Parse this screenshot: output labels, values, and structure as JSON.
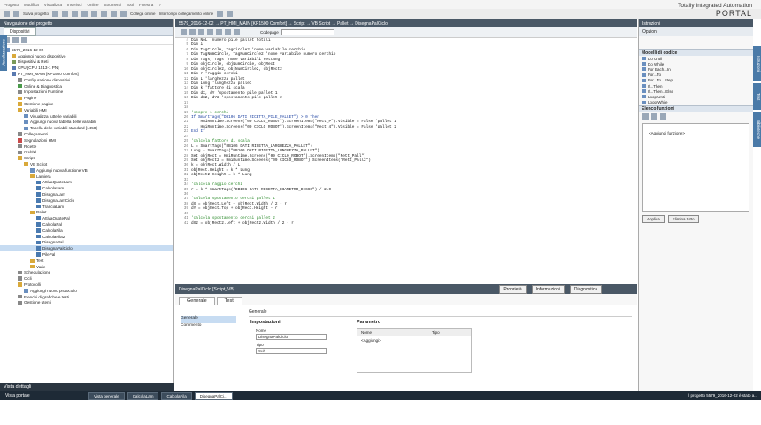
{
  "menu": [
    "Progetto",
    "Modifica",
    "Visualizza",
    "Inserisci",
    "Online",
    "Strumenti",
    "Tool",
    "Finestra",
    "?"
  ],
  "toolbar": {
    "save": "Salva progetto",
    "connect": "Collega online",
    "disconnect": "Interrompi collegamento online"
  },
  "brand": {
    "line1": "Totally Integrated Automation",
    "line2": "PORTAL"
  },
  "nav": {
    "title": "Navigazione del progetto",
    "tab": "Dispositivi",
    "vtab": "Visualizzazione",
    "items": [
      {
        "label": "5579_2016-12-02",
        "indent": 0,
        "icon": "#6a8fbf"
      },
      {
        "label": "Aggiungi nuovo dispositivo",
        "indent": 1,
        "icon": "#d9a93a"
      },
      {
        "label": "Dispositivi & Reti",
        "indent": 1,
        "icon": "#7a9a5a"
      },
      {
        "label": "CPU [CPU 1513-1 PN]",
        "indent": 1,
        "icon": "#5a7ab0"
      },
      {
        "label": "PT_HMI_MAIN [KP1500 Comfort]",
        "indent": 1,
        "icon": "#5a7ab0"
      },
      {
        "label": "Configurazione dispositivi",
        "indent": 2,
        "icon": "#888"
      },
      {
        "label": "Online & Diagnostica",
        "indent": 2,
        "icon": "#4a9a4a"
      },
      {
        "label": "Impostazioni Runtime",
        "indent": 2,
        "icon": "#888"
      },
      {
        "label": "Pagine",
        "indent": 2,
        "icon": "#d9a93a"
      },
      {
        "label": "Gestione pagine",
        "indent": 2,
        "icon": "#d9a93a"
      },
      {
        "label": "Variabili HMI",
        "indent": 2,
        "icon": "#d9a93a"
      },
      {
        "label": "Visualizza tutte le variabili",
        "indent": 3,
        "icon": "#6a8fbf"
      },
      {
        "label": "Aggiungi nuova tabella delle variabili",
        "indent": 3,
        "icon": "#6a8fbf"
      },
      {
        "label": "Tabella delle variabili standard [1458]",
        "indent": 3,
        "icon": "#6a8fbf"
      },
      {
        "label": "Collegamenti",
        "indent": 2,
        "icon": "#888"
      },
      {
        "label": "Segnalazioni HMI",
        "indent": 2,
        "icon": "#c94a4a"
      },
      {
        "label": "Ricette",
        "indent": 2,
        "icon": "#888"
      },
      {
        "label": "Archivi",
        "indent": 2,
        "icon": "#888"
      },
      {
        "label": "Script",
        "indent": 2,
        "icon": "#d9a93a"
      },
      {
        "label": "VB Script",
        "indent": 3,
        "icon": "#d9a93a"
      },
      {
        "label": "Aggiungi nuova funzione VB",
        "indent": 4,
        "icon": "#6a8fbf"
      },
      {
        "label": "Lamiera",
        "indent": 4,
        "icon": "#d9a93a"
      },
      {
        "label": "AttivaQuoteLam",
        "indent": 5,
        "icon": "#4a7ab0"
      },
      {
        "label": "CalcolaLam",
        "indent": 5,
        "icon": "#4a7ab0"
      },
      {
        "label": "DisegnaLam",
        "indent": 5,
        "icon": "#4a7ab0"
      },
      {
        "label": "DisegnaLamCiclo",
        "indent": 5,
        "icon": "#4a7ab0"
      },
      {
        "label": "TranciaLam",
        "indent": 5,
        "icon": "#4a7ab0"
      },
      {
        "label": "Pallet",
        "indent": 4,
        "icon": "#d9a93a"
      },
      {
        "label": "AttivaQuotePal",
        "indent": 5,
        "icon": "#4a7ab0"
      },
      {
        "label": "CalcolaPal",
        "indent": 5,
        "icon": "#4a7ab0"
      },
      {
        "label": "CalcolaFila",
        "indent": 5,
        "icon": "#4a7ab0"
      },
      {
        "label": "CalcolaFila2",
        "indent": 5,
        "icon": "#4a7ab0"
      },
      {
        "label": "DisegnaPal",
        "indent": 5,
        "icon": "#4a7ab0"
      },
      {
        "label": "DisegnaPalCiclo",
        "indent": 5,
        "icon": "#4a7ab0",
        "selected": true
      },
      {
        "label": "PilePal",
        "indent": 5,
        "icon": "#4a7ab0"
      },
      {
        "label": "Test",
        "indent": 4,
        "icon": "#d9a93a"
      },
      {
        "label": "Varie",
        "indent": 4,
        "icon": "#d9a93a"
      },
      {
        "label": "Schedulazione",
        "indent": 2,
        "icon": "#888"
      },
      {
        "label": "Cicli",
        "indent": 2,
        "icon": "#888"
      },
      {
        "label": "Protocolli",
        "indent": 2,
        "icon": "#d9a93a"
      },
      {
        "label": "Aggiungi nuovo protocollo",
        "indent": 3,
        "icon": "#6a8fbf"
      },
      {
        "label": "Elenchi di grafiche e testi",
        "indent": 2,
        "icon": "#888"
      },
      {
        "label": "Gestione utenti",
        "indent": 2,
        "icon": "#888"
      }
    ],
    "details": "Vista dettagli"
  },
  "editor": {
    "title": "5579_2016-12-02 → PT_HMI_MAIN [KP1500 Comfort] → Script → VB Script → Pallet → DisegnaPalCiclo",
    "codepage_label": "Codepage",
    "lines": [
      {
        "n": "4",
        "t": "Dim NoL 'numero pile pallet totali",
        "k": ""
      },
      {
        "n": "5",
        "t": "Dim i",
        "k": ""
      },
      {
        "n": "6",
        "t": "Dim TagCircle, TagCircle2 'nome variabile cerchio",
        "k": ""
      },
      {
        "n": "7",
        "t": "Dim TagNumCircle, TagNumCircle2 'nome variabile numero cerchio",
        "k": ""
      },
      {
        "n": "8",
        "t": "Dim Tags, Tags 'nome variabili rettang",
        "k": ""
      },
      {
        "n": "9",
        "t": "Dim objCircle, objNumCircle, objRect",
        "k": ""
      },
      {
        "n": "10",
        "t": "Dim objCircle2, objNumCircle2, objRect2",
        "k": ""
      },
      {
        "n": "11",
        "t": "Dim r 'raggio cerchi",
        "k": ""
      },
      {
        "n": "12",
        "t": "Dim L 'larghezza pallet",
        "k": ""
      },
      {
        "n": "13",
        "t": "Dim Lung 'lunghezza pallet",
        "k": ""
      },
      {
        "n": "14",
        "t": "Dim k 'fattore di scala",
        "k": ""
      },
      {
        "n": "15",
        "t": "Dim dX, dY 'spostamento pile pallet 1",
        "k": ""
      },
      {
        "n": "16",
        "t": "Dim dX2, dY2 'spostamento pile pallet 2",
        "k": ""
      },
      {
        "n": "17",
        "t": "",
        "k": ""
      },
      {
        "n": "18",
        "t": "",
        "k": ""
      },
      {
        "n": "19",
        "t": "'scopre i cerchi",
        "k": "cm"
      },
      {
        "n": "20",
        "t": "If SmartTags(\"DB106 DATI RICETTA_PILE_PALLET\") > 0 Then",
        "k": "kw"
      },
      {
        "n": "21",
        "t": "    HmiRuntime.Screens(\"09 CICLO_ROBOT\").ScreenItems(\"Rect_P\").Visible = False 'pallet 1",
        "k": ""
      },
      {
        "n": "22",
        "t": "    HmiRuntime.Screens(\"09 CICLO_ROBOT\").ScreenItems(\"Rect_4\").Visible = False 'pallet 2",
        "k": ""
      },
      {
        "n": "23",
        "t": "End If",
        "k": "kw"
      },
      {
        "n": "24",
        "t": "",
        "k": ""
      },
      {
        "n": "25",
        "t": "'calcola fattore di scala",
        "k": "cm"
      },
      {
        "n": "26",
        "t": "L = SmartTags(\"DB106 DATI RICETTA_LARGHEZZA_PALLET\")",
        "k": ""
      },
      {
        "n": "27",
        "t": "Lung = SmartTags(\"DB106 DATI RICETTA_LUNGHEZZA_PALLET\")",
        "k": ""
      },
      {
        "n": "28",
        "t": "Set objRect = HmiRuntime.Screens(\"09 CICLO_ROBOT\").ScreenItems(\"Rett_Pall\")",
        "k": ""
      },
      {
        "n": "29",
        "t": "Set objRect2 = HmiRuntime.Screens(\"09 CICLO_ROBOT\").ScreenItems(\"Rett_Pall2\")",
        "k": ""
      },
      {
        "n": "30",
        "t": "k = objRect.Width / L",
        "k": ""
      },
      {
        "n": "31",
        "t": "objRect.Height = k * Lung",
        "k": ""
      },
      {
        "n": "32",
        "t": "objRect2.Height = k * Lung",
        "k": ""
      },
      {
        "n": "33",
        "t": "",
        "k": ""
      },
      {
        "n": "34",
        "t": "'calcola raggio cerchi",
        "k": "cm"
      },
      {
        "n": "35",
        "t": "r = k * SmartTags(\"DB106 DATI RICETTA_DIAMETRO_DISCO\") / 2.0",
        "k": ""
      },
      {
        "n": "36",
        "t": "",
        "k": ""
      },
      {
        "n": "37",
        "t": "'calcola spostamento cerchi pallet 1",
        "k": "cm"
      },
      {
        "n": "38",
        "t": "dX = objRect.Left + objRect.Width / 2 - r",
        "k": ""
      },
      {
        "n": "39",
        "t": "dY = objRect.Top + objRect.Height - r",
        "k": ""
      },
      {
        "n": "40",
        "t": "",
        "k": ""
      },
      {
        "n": "41",
        "t": "'calcola spostamento cerchi pallet 2",
        "k": "cm"
      },
      {
        "n": "42",
        "t": "dX2 = objRect2.Left + objRect2.Width / 2 - r",
        "k": ""
      }
    ]
  },
  "props": {
    "title": "DisegnaPalCiclo [Script_VB]",
    "tab_props": "Proprietà",
    "tab_info": "Informazioni",
    "tab_diag": "Diagnostica",
    "tabs": [
      "Generale",
      "Testi"
    ],
    "left": [
      "Generale",
      "Commento"
    ],
    "section": "Generale",
    "imp_title": "Impostazioni",
    "name_label": "Nome",
    "name_value": "DisegnaPalCiclo",
    "type_label": "Tipo",
    "type_value": "Sub",
    "par_title": "Parametro",
    "col_name": "Nome",
    "col_type": "Tipo",
    "add_row": "<Aggiungi>"
  },
  "right": {
    "title": "Istruzioni",
    "options": "Opzioni",
    "snip_section": "Modelli di codice",
    "snippets": [
      "Do Until",
      "Do While",
      "For Each...In",
      "For...To",
      "For...To...Step",
      "If...Then",
      "If...Then...Else",
      "Loop Until",
      "Loop While"
    ],
    "func_section": "Elenco funzioni",
    "add_func": "<Aggiungi funzione>",
    "btn_apply": "Applica",
    "btn_clear": "Elimina tutto",
    "vtabs": [
      "Istruzioni",
      "Test",
      "Biblioteche"
    ]
  },
  "status": {
    "portal": "Vista portale",
    "tasks": [
      "Vista generale",
      "CalcolaLam",
      "CalcolaFila",
      "DisegnaPalCi..."
    ],
    "message": "Il progetto 5579_2016-12-02 è stato a..."
  }
}
